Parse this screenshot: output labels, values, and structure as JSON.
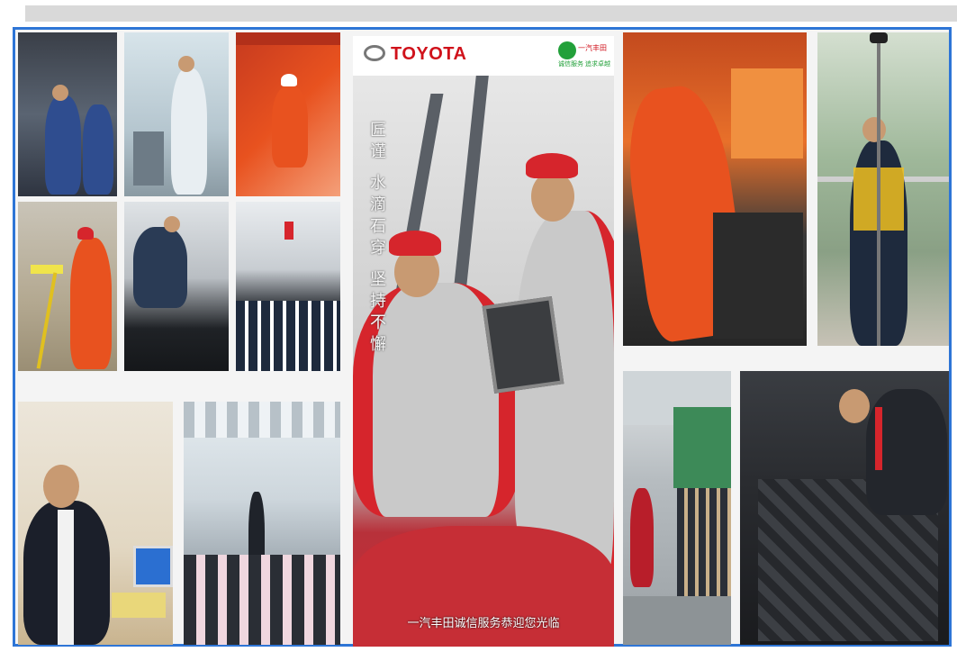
{
  "poster": {
    "brand": "TOYOTA",
    "vertical_text": "匠谨 水滴石穿 坚持不懈",
    "caption": "一汽丰田诚信服务恭迎您光临",
    "badge_top": "一汽丰田",
    "badge_bottom": "诚信服务 追求卓越"
  },
  "colors": {
    "frame_border": "#2e75d6",
    "brand_red": "#d0121b",
    "uniform_orange": "#e8521f",
    "cap_red": "#d6252c",
    "badge_green": "#22a03a"
  },
  "tiles": [
    "mechanics-under-vehicle",
    "technician-at-equipment",
    "orange-workers-on-structure",
    "surveyor-with-tripod",
    "technician-engine-bay",
    "audience-in-hall",
    "man-in-suit-at-desk",
    "lecture-in-glass-hall",
    "orange-worker-at-machine",
    "surveyor-on-balcony",
    "workers-in-workshop",
    "mechanic-engine-closeup"
  ]
}
